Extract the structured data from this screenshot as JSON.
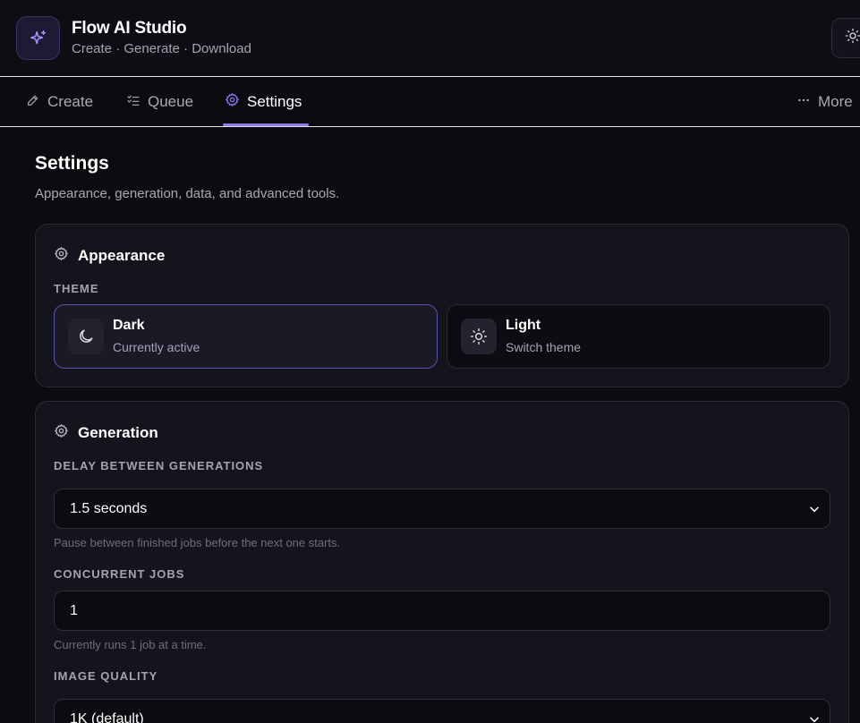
{
  "app": {
    "title": "Flow AI Studio",
    "subtitle": "Create · Generate · Download",
    "accent": "#8b7cf6"
  },
  "tabs": [
    {
      "label": "Create",
      "icon": "pencil-icon",
      "active": false
    },
    {
      "label": "Queue",
      "icon": "list-check-icon",
      "active": false
    },
    {
      "label": "Settings",
      "icon": "gear-icon",
      "active": true
    },
    {
      "label": "More",
      "icon": "ellipsis-icon",
      "active": false
    }
  ],
  "page": {
    "title": "Settings",
    "description": "Appearance, generation, data, and advanced tools."
  },
  "appearance": {
    "title": "Appearance",
    "theme_label": "THEME",
    "options": [
      {
        "title": "Dark",
        "subtitle": "Currently active",
        "icon": "moon-icon",
        "active": true
      },
      {
        "title": "Light",
        "subtitle": "Switch theme",
        "icon": "sun-icon",
        "active": false
      }
    ]
  },
  "generation": {
    "title": "Generation",
    "delay": {
      "label": "DELAY BETWEEN GENERATIONS",
      "value": "1.5 seconds",
      "hint": "Pause between finished jobs before the next one starts."
    },
    "concurrent": {
      "label": "CONCURRENT JOBS",
      "value": "1",
      "hint": "Currently runs 1 job at a time."
    },
    "quality": {
      "label": "IMAGE QUALITY",
      "value": "1K (default)"
    }
  }
}
